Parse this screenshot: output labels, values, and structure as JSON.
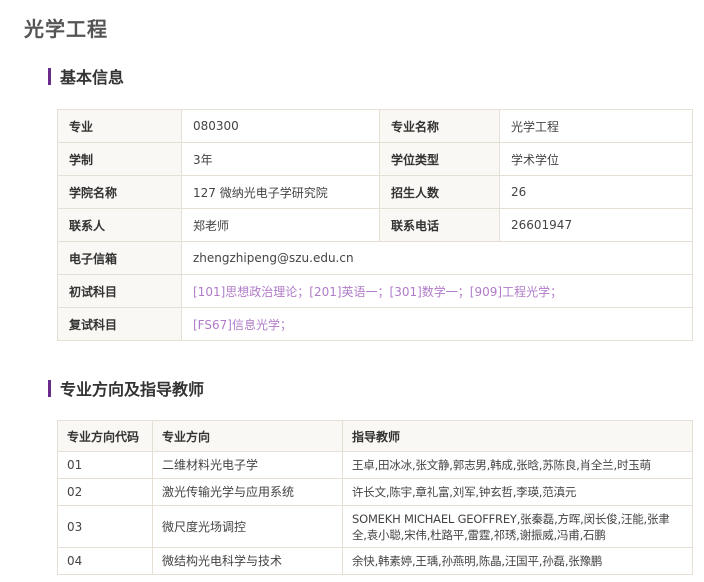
{
  "page": {
    "title": "光学工程"
  },
  "basic_info": {
    "heading": "基本信息",
    "rows": [
      [
        {
          "label": "专业",
          "value": "080300"
        },
        {
          "label": "专业名称",
          "value": "光学工程"
        }
      ],
      [
        {
          "label": "学制",
          "value": "3年"
        },
        {
          "label": "学位类型",
          "value": "学术学位"
        }
      ],
      [
        {
          "label": "学院名称",
          "value": "127 微纳光电子学研究院"
        },
        {
          "label": "招生人数",
          "value": "26"
        }
      ],
      [
        {
          "label": "联系人",
          "value": "郑老师"
        },
        {
          "label": "联系电话",
          "value": "26601947"
        }
      ]
    ],
    "email": {
      "label": "电子信箱",
      "value": "zhengzhipeng@szu.edu.cn"
    },
    "initial_subjects": {
      "label": "初试科目",
      "value": "[101]思想政治理论；[201]英语一；[301]数学一；[909]工程光学；"
    },
    "retest_subjects": {
      "label": "复试科目",
      "value": "[FS67]信息光学；"
    },
    "link_color": "#b07cc8"
  },
  "directions": {
    "heading": "专业方向及指导教师",
    "columns": [
      "专业方向代码",
      "专业方向",
      "指导教师"
    ],
    "rows": [
      {
        "code": "01",
        "name": "二维材料光电子学",
        "teachers": "王卓,田冰冰,张文静,郭志男,韩成,张晗,苏陈良,肖全兰,时玉萌"
      },
      {
        "code": "02",
        "name": "激光传输光学与应用系统",
        "teachers": "许长文,陈宇,章礼富,刘军,钟玄哲,李瑛,范滇元"
      },
      {
        "code": "03",
        "name": "微尺度光场调控",
        "teachers": "SOMEKH MICHAEL GEOFFREY,张秦磊,方晖,闵长俊,汪能,张聿全,袁小聪,宋伟,杜路平,雷霆,祁琇,谢振威,冯甫,石鹏"
      },
      {
        "code": "04",
        "name": "微结构光电科学与技术",
        "teachers": "余快,韩素婷,王瑀,孙燕明,陈晶,汪国平,孙磊,张豫鹏"
      }
    ]
  },
  "accent_color": "#6a2c8a"
}
